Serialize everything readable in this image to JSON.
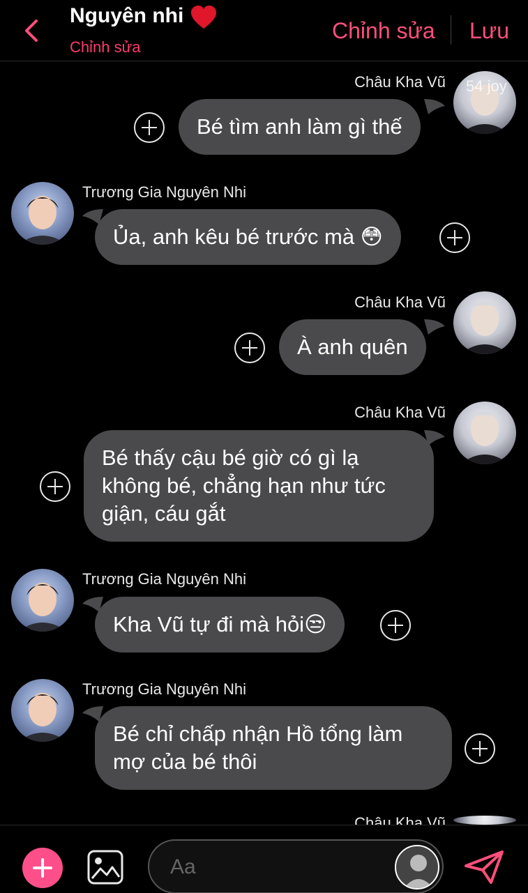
{
  "header": {
    "title": "Nguyên nhi",
    "subtitle": "Chỉnh sửa",
    "edit_label": "Chỉnh sửa",
    "save_label": "Lưu"
  },
  "badge": "54 joy",
  "messages": [
    {
      "sender": "Châu Kha Vũ",
      "side": "right",
      "text": "Bé tìm anh làm gì thế"
    },
    {
      "sender": "Trương Gia Nguyên Nhi",
      "side": "left",
      "text": "Ủa, anh kêu bé trước mà 😳"
    },
    {
      "sender": "Châu Kha Vũ",
      "side": "right",
      "text": "À anh quên"
    },
    {
      "sender": "Châu Kha Vũ",
      "side": "right",
      "text": "Bé thấy cậu bé giờ có gì lạ không bé, chẳng hạn như tức giận, cáu gắt"
    },
    {
      "sender": "Trương Gia Nguyên Nhi",
      "side": "left",
      "text": "Kha Vũ tự đi mà hỏi😒"
    },
    {
      "sender": "Trương Gia Nguyên Nhi",
      "side": "left",
      "text": "Bé chỉ chấp nhận Hồ tổng làm mợ của bé thôi"
    },
    {
      "sender": "Châu Kha Vũ",
      "side": "right",
      "text": ""
    }
  ],
  "composer": {
    "placeholder": "Aa"
  },
  "icons": {
    "back": "chevron-left-icon",
    "heart": "heart-icon",
    "add": "plus-icon",
    "image": "image-icon",
    "send": "send-icon"
  },
  "colors": {
    "accent": "#ff4f7b",
    "bubble": "#4a4a4c",
    "background": "#000000"
  }
}
